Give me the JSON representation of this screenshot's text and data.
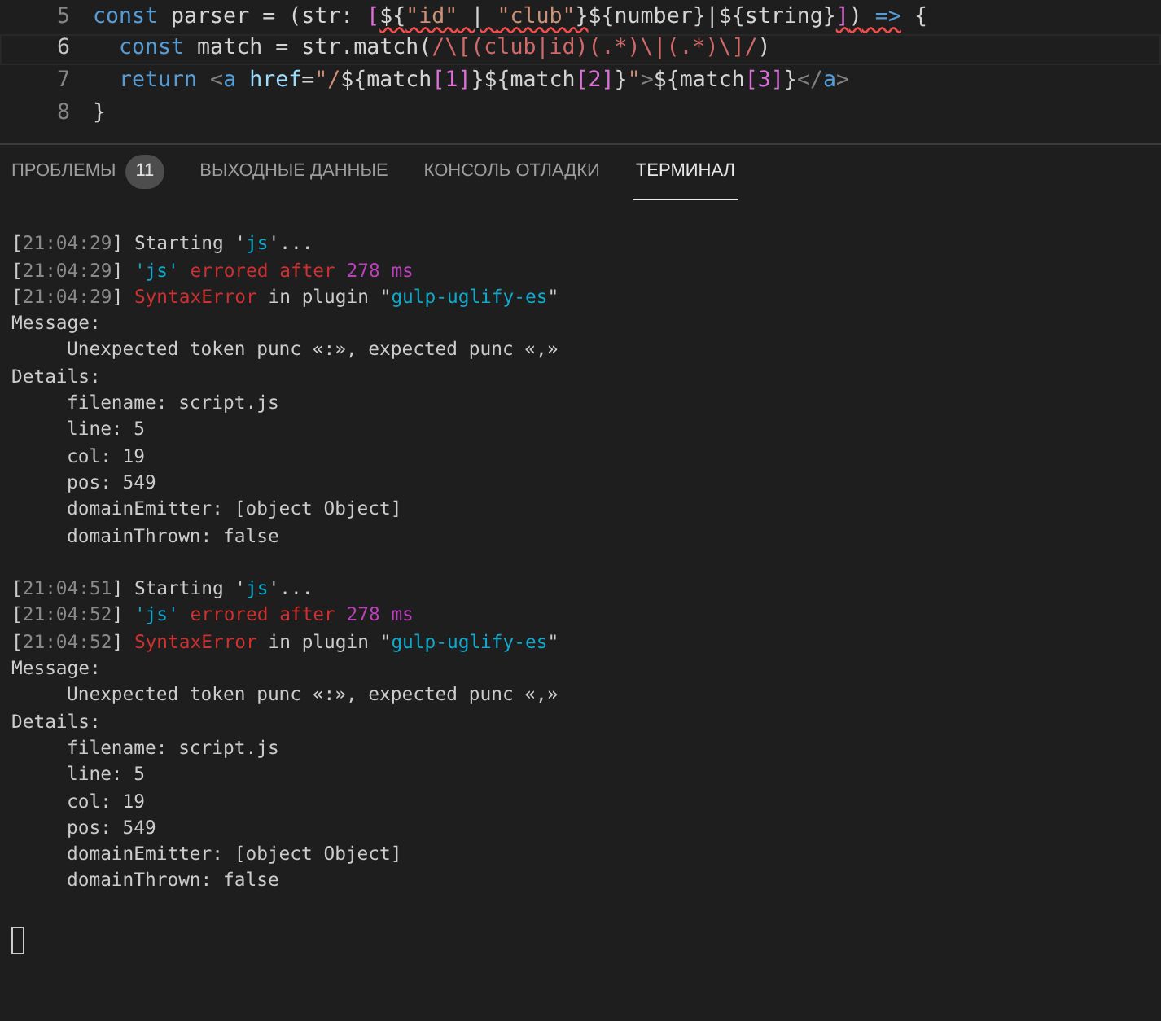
{
  "editor": {
    "lines": [
      {
        "number": "5",
        "current": false,
        "tokens": [
          {
            "text": "const",
            "kind": "kw"
          },
          {
            "text": " parser = (str: ",
            "kind": "plain"
          },
          {
            "text": "[",
            "kind": "bracket"
          },
          {
            "text": "${",
            "kind": "plain",
            "error": true
          },
          {
            "text": "\"id\"",
            "kind": "str",
            "error": true
          },
          {
            "text": " | ",
            "kind": "plain",
            "error": true
          },
          {
            "text": "\"club\"",
            "kind": "str",
            "error": true
          },
          {
            "text": "}",
            "kind": "plain",
            "error": true
          },
          {
            "text": "${number}|${string}",
            "kind": "plain"
          },
          {
            "text": "]",
            "kind": "bracket",
            "error": true
          },
          {
            "text": ")",
            "kind": "plain",
            "error": true
          },
          {
            "text": " =>",
            "kind": "kw",
            "error": true
          },
          {
            "text": " {",
            "kind": "plain"
          }
        ]
      },
      {
        "number": "6",
        "current": true,
        "tokens": [
          {
            "text": "  const",
            "kind": "kw"
          },
          {
            "text": " match = str.match(",
            "kind": "plain"
          },
          {
            "text": "/\\[(club|id)(.*)\\|(.*)\\]/",
            "kind": "regex"
          },
          {
            "text": ")",
            "kind": "plain"
          }
        ]
      },
      {
        "number": "7",
        "current": false,
        "tokens": [
          {
            "text": "  return",
            "kind": "kw"
          },
          {
            "text": " <",
            "kind": "tag"
          },
          {
            "text": "a",
            "kind": "kw"
          },
          {
            "text": " href",
            "kind": "var"
          },
          {
            "text": "=",
            "kind": "plain"
          },
          {
            "text": "\"/",
            "kind": "str"
          },
          {
            "text": "${match",
            "kind": "plain"
          },
          {
            "text": "[1]",
            "kind": "bracket"
          },
          {
            "text": "}${match",
            "kind": "plain"
          },
          {
            "text": "[2]",
            "kind": "bracket"
          },
          {
            "text": "}",
            "kind": "plain"
          },
          {
            "text": "\"",
            "kind": "str"
          },
          {
            "text": ">",
            "kind": "tag"
          },
          {
            "text": "${match",
            "kind": "plain"
          },
          {
            "text": "[3]",
            "kind": "bracket"
          },
          {
            "text": "}",
            "kind": "plain"
          },
          {
            "text": "</",
            "kind": "tag"
          },
          {
            "text": "a",
            "kind": "kw"
          },
          {
            "text": ">",
            "kind": "tag"
          }
        ]
      },
      {
        "number": "8",
        "current": false,
        "tokens": [
          {
            "text": "}",
            "kind": "plain"
          }
        ]
      }
    ]
  },
  "panel_tabs": [
    {
      "label": "ПРОБЛЕМЫ",
      "badge": "11",
      "selected": false
    },
    {
      "label": "ВЫХОДНЫЕ ДАННЫЕ",
      "selected": false
    },
    {
      "label": "КОНСОЛЬ ОТЛАДКИ",
      "selected": false
    },
    {
      "label": "ТЕРМИНАЛ",
      "selected": true
    }
  ],
  "terminal": {
    "lines": [
      {
        "kind": "blank"
      },
      {
        "kind": "text",
        "time": "[21:04:29]",
        "tokens": [
          {
            "text": "Starting '",
            "kind": "plain"
          },
          {
            "text": "js",
            "kind": "cyan"
          },
          {
            "text": "'...",
            "kind": "plain"
          }
        ]
      },
      {
        "kind": "text",
        "time": "[21:04:29]",
        "tokens": [
          {
            "text": "'js'",
            "kind": "cyan"
          },
          {
            "text": " errored after ",
            "kind": "red"
          },
          {
            "text": "278 ms",
            "kind": "magenta"
          }
        ]
      },
      {
        "kind": "text",
        "time": "[21:04:29]",
        "tokens": [
          {
            "text": "SyntaxError",
            "kind": "red"
          },
          {
            "text": " in plugin \"",
            "kind": "plain"
          },
          {
            "text": "gulp-uglify-es",
            "kind": "cyan"
          },
          {
            "text": "\"",
            "kind": "plain"
          }
        ]
      },
      {
        "kind": "text",
        "tokens": [
          {
            "text": "Message:",
            "kind": "plain"
          }
        ],
        "children": [
          {
            "kind": "text",
            "tokens": [
              {
                "text": "Unexpected token punc «:», expected punc «,»",
                "kind": "plain"
              }
            ]
          }
        ]
      },
      {
        "kind": "text",
        "tokens": [
          {
            "text": "Details:",
            "kind": "plain"
          }
        ],
        "children": [
          {
            "kind": "text",
            "tokens": [
              {
                "text": "filename: script.js",
                "kind": "plain"
              }
            ]
          },
          {
            "kind": "text",
            "tokens": [
              {
                "text": "line: 5",
                "kind": "plain"
              }
            ]
          },
          {
            "kind": "text",
            "tokens": [
              {
                "text": "col: 19",
                "kind": "plain"
              }
            ]
          },
          {
            "kind": "text",
            "tokens": [
              {
                "text": "pos: 549",
                "kind": "plain"
              }
            ]
          },
          {
            "kind": "text",
            "tokens": [
              {
                "text": "domainEmitter: [object Object]",
                "kind": "plain"
              }
            ]
          },
          {
            "kind": "text",
            "tokens": [
              {
                "text": "domainThrown: false",
                "kind": "plain"
              }
            ]
          }
        ]
      },
      {
        "kind": "blank"
      },
      {
        "kind": "text",
        "time": "[21:04:51]",
        "tokens": [
          {
            "text": "Starting '",
            "kind": "plain"
          },
          {
            "text": "js",
            "kind": "cyan"
          },
          {
            "text": "'...",
            "kind": "plain"
          }
        ]
      },
      {
        "kind": "text",
        "time": "[21:04:52]",
        "tokens": [
          {
            "text": "'js'",
            "kind": "cyan"
          },
          {
            "text": " errored after ",
            "kind": "red"
          },
          {
            "text": "278 ms",
            "kind": "magenta"
          }
        ]
      },
      {
        "kind": "text",
        "time": "[21:04:52]",
        "tokens": [
          {
            "text": "SyntaxError",
            "kind": "red"
          },
          {
            "text": " in plugin \"",
            "kind": "plain"
          },
          {
            "text": "gulp-uglify-es",
            "kind": "cyan"
          },
          {
            "text": "\"",
            "kind": "plain"
          }
        ]
      },
      {
        "kind": "text",
        "tokens": [
          {
            "text": "Message:",
            "kind": "plain"
          }
        ],
        "children": [
          {
            "kind": "text",
            "tokens": [
              {
                "text": "Unexpected token punc «:», expected punc «,»",
                "kind": "plain"
              }
            ]
          }
        ]
      },
      {
        "kind": "text",
        "tokens": [
          {
            "text": "Details:",
            "kind": "plain"
          }
        ],
        "children": [
          {
            "kind": "text",
            "tokens": [
              {
                "text": "filename: script.js",
                "kind": "plain"
              }
            ]
          },
          {
            "kind": "text",
            "tokens": [
              {
                "text": "line: 5",
                "kind": "plain"
              }
            ]
          },
          {
            "kind": "text",
            "tokens": [
              {
                "text": "col: 19",
                "kind": "plain"
              }
            ]
          },
          {
            "kind": "text",
            "tokens": [
              {
                "text": "pos: 549",
                "kind": "plain"
              }
            ]
          },
          {
            "kind": "text",
            "tokens": [
              {
                "text": "domainEmitter: [object Object]",
                "kind": "plain"
              }
            ]
          },
          {
            "kind": "text",
            "tokens": [
              {
                "text": "domainThrown: false",
                "kind": "plain"
              }
            ]
          }
        ]
      },
      {
        "kind": "blank"
      },
      {
        "kind": "cursor"
      }
    ]
  }
}
